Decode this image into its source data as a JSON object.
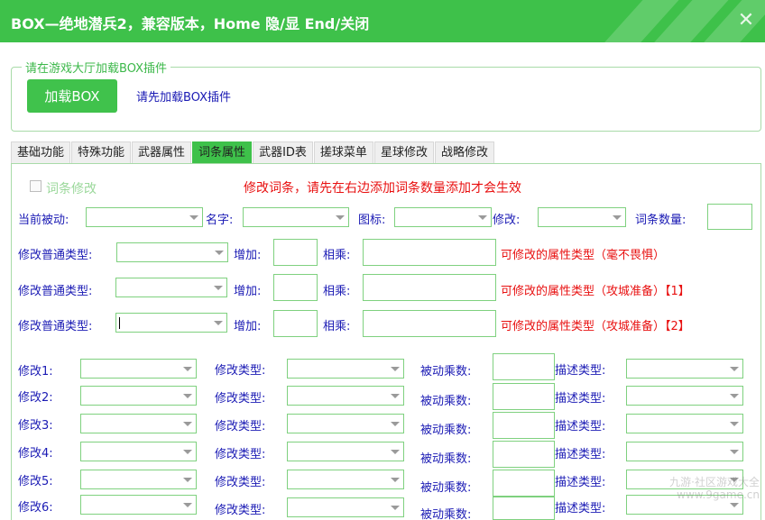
{
  "window": {
    "title": "BOX—绝地潜兵2，兼容版本，Home 隐/显  End/关闭",
    "close_glyph": "✕"
  },
  "loader": {
    "legend": "请在游戏大厅加载BOX插件",
    "button": "加载BOX",
    "hint": "请先加载BOX插件"
  },
  "tabs": [
    {
      "label": "基础功能",
      "active": false
    },
    {
      "label": "特殊功能",
      "active": false
    },
    {
      "label": "武器属性",
      "active": false
    },
    {
      "label": "词条属性",
      "active": true
    },
    {
      "label": "武器ID表",
      "active": false
    },
    {
      "label": "搓球菜单",
      "active": false
    },
    {
      "label": "星球修改",
      "active": false
    },
    {
      "label": "战略修改",
      "active": false
    }
  ],
  "panel": {
    "checkbox_label": "词条修改",
    "warning": "修改词条，请先在右边添加词条数量添加才会生效",
    "current_passive": "当前被动:",
    "name": "名字:",
    "icon": "图标:",
    "modify": "修改:",
    "entry_count": "词条数量:",
    "type_label": "修改普通类型:",
    "add_label": "增加:",
    "mult_label": "相乘:",
    "type_rows": [
      {
        "note": "可修改的属性类型（毫不畏惧）"
      },
      {
        "note": "可修改的属性类型（攻城准备）【1】"
      },
      {
        "note": "可修改的属性类型（攻城准备）【2】"
      }
    ],
    "grid_col2": "修改类型:",
    "grid_col3": "被动乘数:",
    "grid_col4": "描述类型:",
    "grid_rows": [
      {
        "label": "修改1:"
      },
      {
        "label": "修改2:"
      },
      {
        "label": "修改3:"
      },
      {
        "label": "修改4:"
      },
      {
        "label": "修改5:"
      },
      {
        "label": "修改6:"
      }
    ]
  },
  "watermark": "九游·社区游戏大全\nwww.9game.cn",
  "colors": {
    "accent": "#3ec14a",
    "label_text": "#1a1ab4",
    "warning_text": "#e81010",
    "field_border": "#7fd17f"
  }
}
